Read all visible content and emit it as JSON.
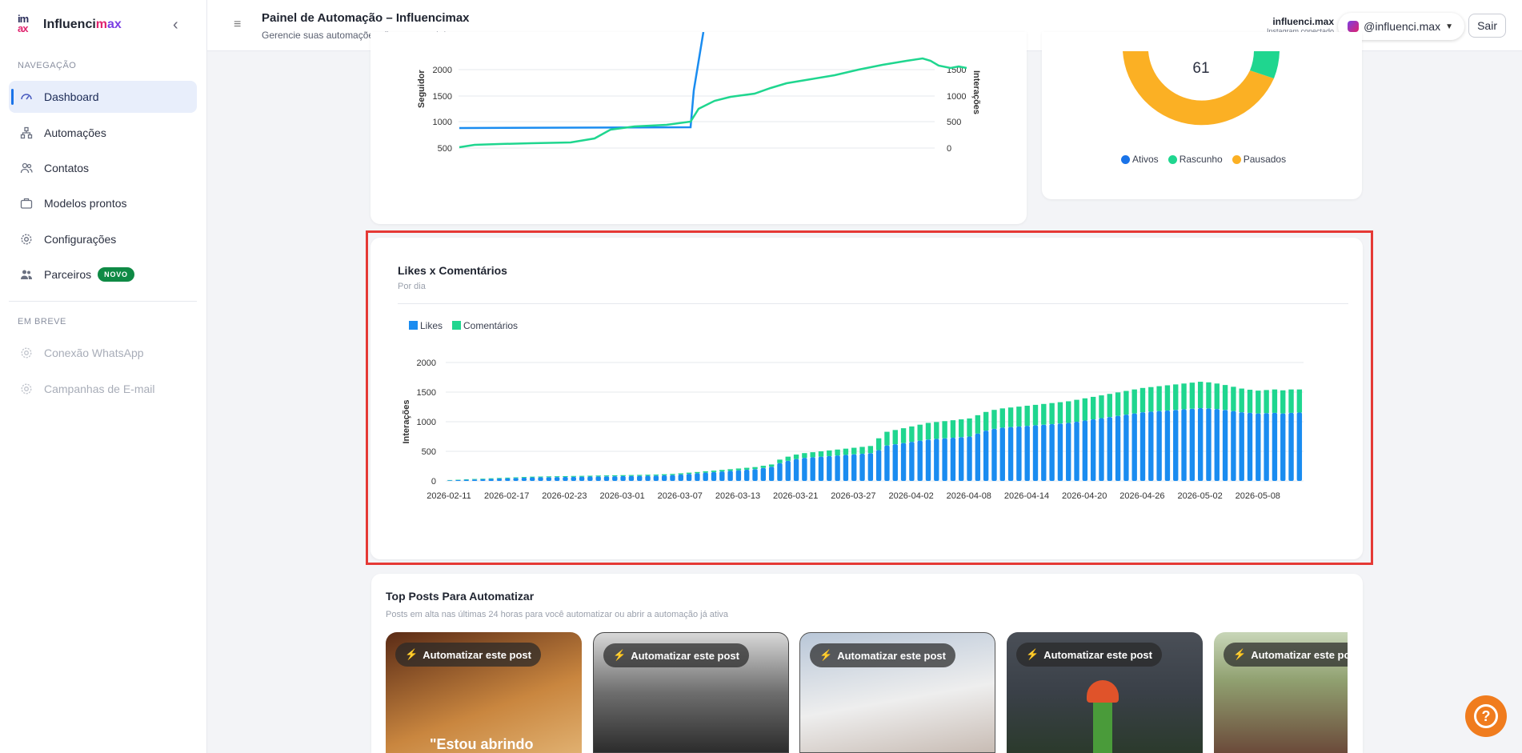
{
  "sidebar": {
    "brand": {
      "prefix": "Influenci",
      "mid": "m",
      "suffix_a": "a",
      "suffix_x": "x",
      "logo_top": "im",
      "logo_bottom": "ax"
    },
    "nav_section": "NAVEGAÇÃO",
    "items": [
      {
        "label": "Dashboard",
        "icon": "gauge-icon"
      },
      {
        "label": "Automações",
        "icon": "flow-icon"
      },
      {
        "label": "Contatos",
        "icon": "users-icon"
      },
      {
        "label": "Modelos prontos",
        "icon": "briefcase-icon"
      },
      {
        "label": "Configurações",
        "icon": "gear-icon"
      },
      {
        "label": "Parceiros",
        "icon": "partners-icon",
        "badge": "NOVO"
      }
    ],
    "soon_section": "EM BREVE",
    "soon_items": [
      {
        "label": "Conexão WhatsApp",
        "icon": "gear-icon"
      },
      {
        "label": "Campanhas de E-mail",
        "icon": "gear-icon"
      }
    ]
  },
  "header": {
    "title": "Painel de Automação – Influencimax",
    "subtitle": "Gerencie suas automações, fluxos e modelos",
    "account_name": "influenci.max",
    "account_status": "Instagram conectado",
    "account_handle": "@influenci.max",
    "logout_label": "Sair"
  },
  "growth_chart": {
    "left_axis_label": "Seguidor",
    "right_axis_label": "Interações",
    "left_ticks": [
      "2000",
      "1500",
      "1000",
      "500"
    ],
    "right_ticks": [
      "1500",
      "1000",
      "500",
      "0"
    ]
  },
  "status_card": {
    "total": "61",
    "legend": [
      "Ativos",
      "Rascunho",
      "Pausados"
    ],
    "colors": {
      "ativos": "#1a73e8",
      "rascunho": "#1fd68f",
      "pausados": "#fbb024"
    }
  },
  "likes_card": {
    "title": "Likes x Comentários",
    "subtitle": "Por dia"
  },
  "chart_data": {
    "type": "bar",
    "title": "Likes x Comentários",
    "subtitle": "Por dia",
    "ylabel": "Interações",
    "ylim": [
      0,
      2000
    ],
    "yticks": [
      0,
      500,
      1000,
      1500,
      2000
    ],
    "stacked": true,
    "x_tick_labels": [
      "2026-02-11",
      "2026-02-17",
      "2026-02-23",
      "2026-03-01",
      "2026-03-07",
      "2026-03-13",
      "2026-03-21",
      "2026-03-27",
      "2026-04-02",
      "2026-04-08",
      "2026-04-14",
      "2026-04-20",
      "2026-04-26",
      "2026-05-02",
      "2026-05-08"
    ],
    "series": [
      {
        "name": "Likes",
        "color": "#1a8cf0",
        "values": [
          10,
          15,
          20,
          25,
          30,
          35,
          40,
          45,
          50,
          55,
          60,
          62,
          64,
          66,
          68,
          70,
          72,
          74,
          76,
          78,
          80,
          82,
          84,
          86,
          88,
          90,
          95,
          100,
          110,
          120,
          130,
          140,
          150,
          160,
          170,
          180,
          190,
          200,
          220,
          240,
          300,
          340,
          370,
          390,
          400,
          410,
          420,
          430,
          440,
          450,
          460,
          470,
          520,
          600,
          620,
          640,
          660,
          680,
          700,
          710,
          720,
          730,
          740,
          750,
          800,
          850,
          880,
          900,
          910,
          920,
          930,
          940,
          950,
          960,
          970,
          980,
          1000,
          1020,
          1040,
          1060,
          1080,
          1100,
          1120,
          1140,
          1160,
          1170,
          1180,
          1190,
          1200,
          1210,
          1220,
          1230,
          1225,
          1215,
          1200,
          1180,
          1160,
          1150,
          1140,
          1145,
          1150,
          1140,
          1150,
          1155
        ]
      },
      {
        "name": "Comentários",
        "color": "#1fd68f",
        "values": [
          5,
          6,
          7,
          8,
          9,
          10,
          10,
          11,
          11,
          12,
          12,
          12,
          13,
          13,
          13,
          14,
          14,
          14,
          15,
          15,
          15,
          16,
          16,
          16,
          17,
          17,
          18,
          18,
          19,
          20,
          21,
          22,
          24,
          26,
          28,
          30,
          32,
          34,
          36,
          38,
          60,
          70,
          75,
          80,
          85,
          90,
          95,
          100,
          105,
          110,
          115,
          120,
          200,
          230,
          240,
          250,
          260,
          270,
          280,
          285,
          290,
          295,
          300,
          305,
          310,
          315,
          320,
          325,
          330,
          335,
          340,
          345,
          350,
          355,
          360,
          365,
          370,
          375,
          380,
          385,
          390,
          395,
          400,
          405,
          410,
          415,
          420,
          425,
          430,
          435,
          440,
          445,
          440,
          430,
          420,
          410,
          400,
          390,
          385,
          390,
          395,
          390,
          395,
          390
        ]
      }
    ],
    "legend_position": "top-left"
  },
  "top_posts": {
    "title": "Top Posts Para Automatizar",
    "subtitle": "Posts em alta nas últimas 24 horas para você automatizar ou abrir a automação já ativa",
    "button_label": "Automatizar este post",
    "first_caption": "\"Estou abrindo"
  }
}
